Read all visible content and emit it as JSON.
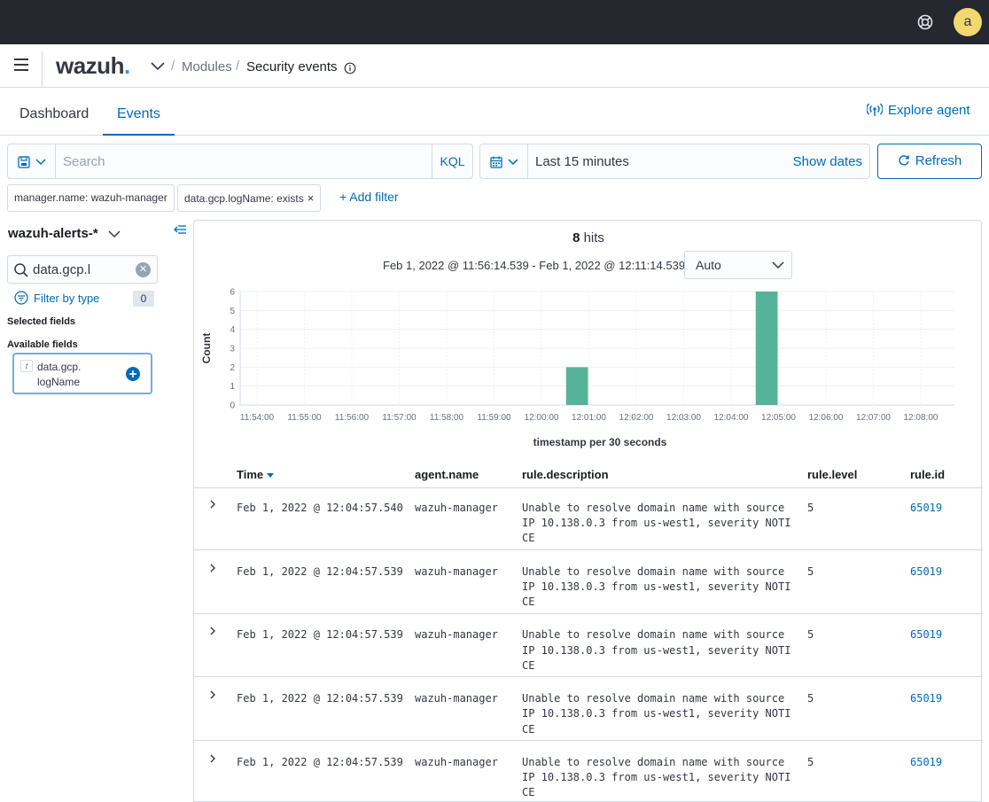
{
  "user": {
    "avatar_initial": "a"
  },
  "nav": {
    "logo_text": "wazuh",
    "logo_dot": ".",
    "breadcrumb_modules": "Modules",
    "breadcrumb_title": "Security events",
    "separator": "/"
  },
  "tabs": [
    {
      "label": "Dashboard",
      "active": false
    },
    {
      "label": "Events",
      "active": true
    }
  ],
  "explore_agent_label": "Explore agent",
  "query": {
    "placeholder": "Search",
    "language": "KQL"
  },
  "datepicker": {
    "range": "Last 15 minutes",
    "show_dates_label": "Show dates"
  },
  "refresh_label": "Refresh",
  "filters": [
    {
      "label": "manager.name: wazuh-manager"
    },
    {
      "label": "data.gcp.logName: exists",
      "removable_glyph": "×"
    }
  ],
  "add_filter_label": "+ Add filter",
  "sidebar": {
    "index_pattern": "wazuh-alerts-*",
    "field_search_value": "data.gcp.l",
    "filter_by_type_label": "Filter by type",
    "filter_count": "0",
    "selected_fields_label": "Selected fields",
    "available_fields_label": "Available fields",
    "available_fields": [
      {
        "type_glyph": "t",
        "name_line1": "data.gcp.",
        "name_line2": "logName"
      }
    ]
  },
  "histogram": {
    "hits_count": "8",
    "hits_label": "hits",
    "time_range": "Feb 1, 2022 @ 11:56:14.539 - Feb 1, 2022 @ 12:11:14.539",
    "interval": "Auto"
  },
  "chart_data": {
    "type": "bar",
    "xlabel": "timestamp per 30 seconds",
    "ylabel": "Count",
    "ylim": [
      0,
      6
    ],
    "y_ticks": [
      0,
      1,
      2,
      3,
      4,
      5,
      6
    ],
    "x_ticks": [
      "11:54:00",
      "11:55:00",
      "11:56:00",
      "11:57:00",
      "11:58:00",
      "11:59:00",
      "12:00:00",
      "12:01:00",
      "12:02:00",
      "12:03:00",
      "12:04:00",
      "12:05:00",
      "12:06:00",
      "12:07:00",
      "12:08:00"
    ],
    "bars": [
      {
        "start": "12:00:30",
        "value": 2
      },
      {
        "start": "12:04:30",
        "value": 6
      }
    ],
    "color": "#54b399",
    "grid": true
  },
  "table": {
    "columns": [
      "Time",
      "agent.name",
      "rule.description",
      "rule.level",
      "rule.id"
    ],
    "rows": [
      {
        "time": "Feb 1, 2022 @ 12:04:57.540",
        "agent": "wazuh-manager",
        "description": "Unable to resolve domain name with source IP 10.138.0.3 from us-west1, severity NOTICE",
        "level": "5",
        "rule_id": "65019"
      },
      {
        "time": "Feb 1, 2022 @ 12:04:57.539",
        "agent": "wazuh-manager",
        "description": "Unable to resolve domain name with source IP 10.138.0.3 from us-west1, severity NOTICE",
        "level": "5",
        "rule_id": "65019"
      },
      {
        "time": "Feb 1, 2022 @ 12:04:57.539",
        "agent": "wazuh-manager",
        "description": "Unable to resolve domain name with source IP 10.138.0.3 from us-west1, severity NOTICE",
        "level": "5",
        "rule_id": "65019"
      },
      {
        "time": "Feb 1, 2022 @ 12:04:57.539",
        "agent": "wazuh-manager",
        "description": "Unable to resolve domain name with source IP 10.138.0.3 from us-west1, severity NOTICE",
        "level": "5",
        "rule_id": "65019"
      },
      {
        "time": "Feb 1, 2022 @ 12:04:57.539",
        "agent": "wazuh-manager",
        "description": "Unable to resolve domain name with source IP 10.138.0.3 from us-west1, severity NOTICE",
        "level": "5",
        "rule_id": "65019"
      }
    ]
  }
}
